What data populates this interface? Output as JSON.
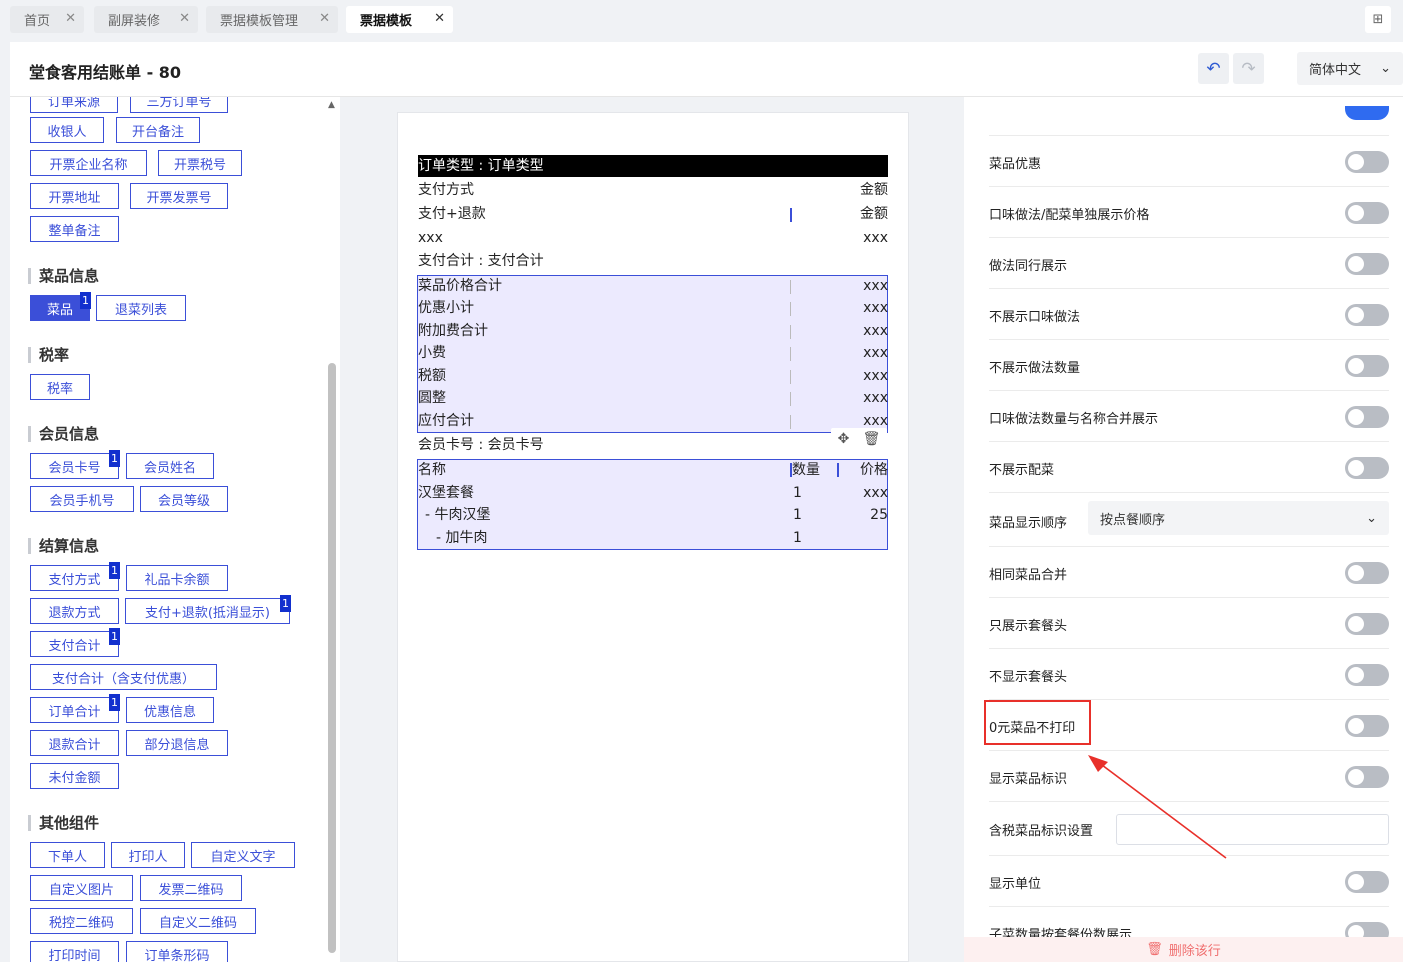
{
  "tabs": [
    {
      "label": "首页"
    },
    {
      "label": "副屏装修"
    },
    {
      "label": "票据模板管理"
    },
    {
      "label": "票据模板"
    }
  ],
  "header": {
    "title": "堂食客用结账单 - 80",
    "language": "简体中文"
  },
  "left": {
    "top_fields": [
      "订单来源",
      "三方订单号",
      "收银人",
      "开台备注",
      "开票企业名称",
      "开票税号",
      "开票地址",
      "开票发票号",
      "整单备注"
    ],
    "sections": {
      "dish": "菜品信息",
      "tax": "税率",
      "member": "会员信息",
      "settlement": "结算信息",
      "other": "其他组件"
    },
    "dish_fields": [
      "菜品",
      "退菜列表"
    ],
    "tax_fields": [
      "税率"
    ],
    "member_fields": [
      "会员卡号",
      "会员姓名",
      "会员手机号",
      "会员等级"
    ],
    "settlement_fields": [
      "支付方式",
      "礼品卡余额",
      "退款方式",
      "支付+退款(抵消显示)",
      "支付合计",
      "支付合计（含支付优惠）",
      "订单合计",
      "优惠信息",
      "退款合计",
      "部分退信息",
      "未付金额"
    ],
    "other_fields": [
      "下单人",
      "打印人",
      "自定义文字",
      "自定义图片",
      "发票二维码",
      "税控二维码",
      "自定义二维码",
      "打印时间",
      "订单条形码"
    ],
    "badge": "1"
  },
  "receipt": {
    "order_type": "订单类型 : 订单类型",
    "pay_method": "支付方式",
    "amount": "金额",
    "pay_refund": "支付+退款",
    "xxx": "xxx",
    "pay_total": "支付合计 : 支付合计",
    "summary": [
      "菜品价格合计",
      "优惠小计",
      "附加费合计",
      "小费",
      "税额",
      "圆整",
      "应付合计"
    ],
    "member_card": "会员卡号 : 会员卡号",
    "table_headers": {
      "name": "名称",
      "qty": "数量",
      "price": "价格"
    },
    "items": [
      {
        "name": "汉堡套餐",
        "qty": "1",
        "price": "xxx"
      },
      {
        "name": " - 牛肉汉堡",
        "qty": "1",
        "price": "25"
      },
      {
        "name": "   - 加牛肉",
        "qty": "1",
        "price": ""
      }
    ]
  },
  "settings": {
    "rows": [
      "菜品优惠",
      "口味做法/配菜单独展示价格",
      "做法同行展示",
      "不展示口味做法",
      "不展示做法数量",
      "口味做法数量与名称合并展示",
      "不展示配菜"
    ],
    "dish_order_label": "菜品显示顺序",
    "dish_order_value": "按点餐顺序",
    "rows2": [
      "相同菜品合并",
      "只展示套餐头",
      "不显示套餐头",
      "0元菜品不打印",
      "显示菜品标识"
    ],
    "tax_mark_label": "含税菜品标识设置",
    "rows3": [
      "显示单位",
      "子菜数量按套餐份数展示"
    ],
    "delete_row": "删除该行"
  }
}
